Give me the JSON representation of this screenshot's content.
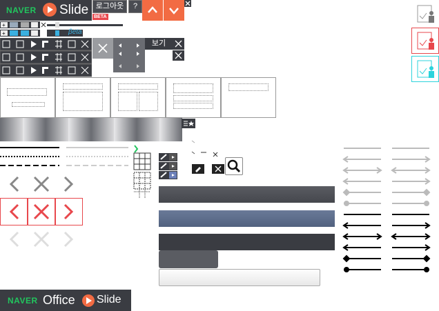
{
  "header": {
    "brand": "NAVER",
    "product": "Slide",
    "logout_label": "로그아웃",
    "help_label": "?",
    "beta_badge": "BETA",
    "beta_text": "βeta"
  },
  "viewer": {
    "view_label": "보기"
  },
  "footer": {
    "brand": "NAVER",
    "office": "Office",
    "product": "Slide"
  },
  "colors": {
    "accent": "#f26b43",
    "dark": "#3a3c42",
    "red": "#e8474c",
    "cyan": "#2cd3dc",
    "slate": "#5b6b88",
    "green": "#22c55e"
  },
  "icons": {
    "up": "chevron-up-icon",
    "down": "chevron-down-icon",
    "close": "close-icon",
    "search": "search-icon",
    "eraser": "eraser-icon"
  }
}
